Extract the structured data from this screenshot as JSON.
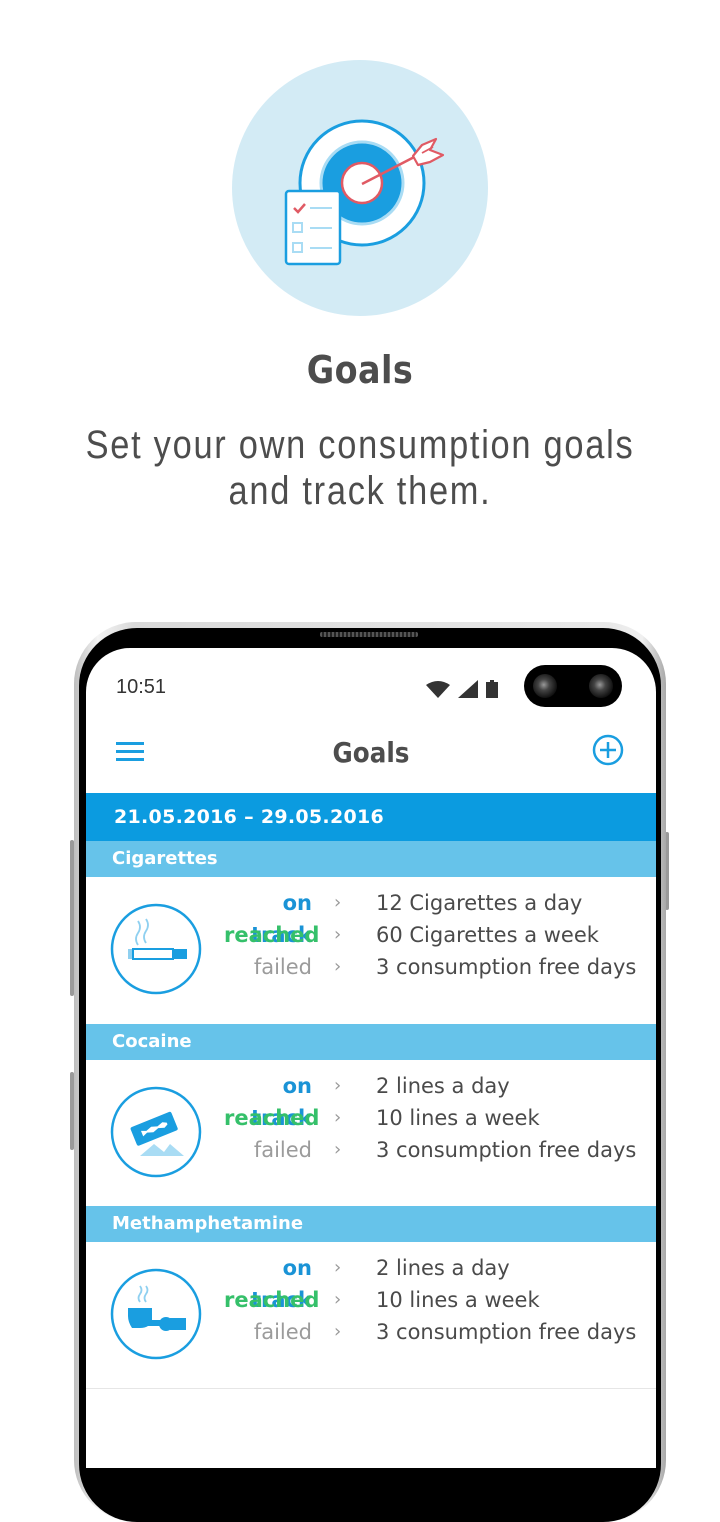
{
  "promo": {
    "title": "Goals",
    "subtitle_line1": "Set your own consumption goals",
    "subtitle_line2": "and track them.",
    "hero_icon": "target-with-checklist-icon"
  },
  "status_bar": {
    "time": "10:51",
    "icons": [
      "wifi-icon",
      "cell-signal-icon",
      "battery-icon"
    ]
  },
  "app_bar": {
    "title": "Goals",
    "menu_icon": "hamburger-menu-icon",
    "add_icon": "add-circle-icon"
  },
  "date_range": "21.05.2016 – 29.05.2016",
  "colors": {
    "primary": "#0b9be0",
    "section": "#66c3ea",
    "on_track": "#1a93d6",
    "reached": "#35c06a",
    "failed": "#9b9b9b",
    "hero_bg": "#d3ebf5",
    "accent_red": "#e05a64"
  },
  "sections": [
    {
      "name": "Cigarettes",
      "icon": "cigarette-icon",
      "goals": [
        {
          "status": "on track",
          "desc": "12 Cigarettes a day"
        },
        {
          "status": "reached",
          "desc": "60 Cigarettes a week"
        },
        {
          "status": "failed",
          "desc": "3 consumption free days"
        }
      ]
    },
    {
      "name": "Cocaine",
      "icon": "razor-blade-icon",
      "goals": [
        {
          "status": "on track",
          "desc": "2 lines a day"
        },
        {
          "status": "reached",
          "desc": "10 lines a week"
        },
        {
          "status": "failed",
          "desc": "3 consumption free days"
        }
      ]
    },
    {
      "name": "Methamphetamine",
      "icon": "pipe-icon",
      "goals": [
        {
          "status": "on track",
          "desc": "2 lines a day"
        },
        {
          "status": "reached",
          "desc": "10 lines a week"
        },
        {
          "status": "failed",
          "desc": "3 consumption free days"
        }
      ]
    }
  ],
  "chevron": "›"
}
